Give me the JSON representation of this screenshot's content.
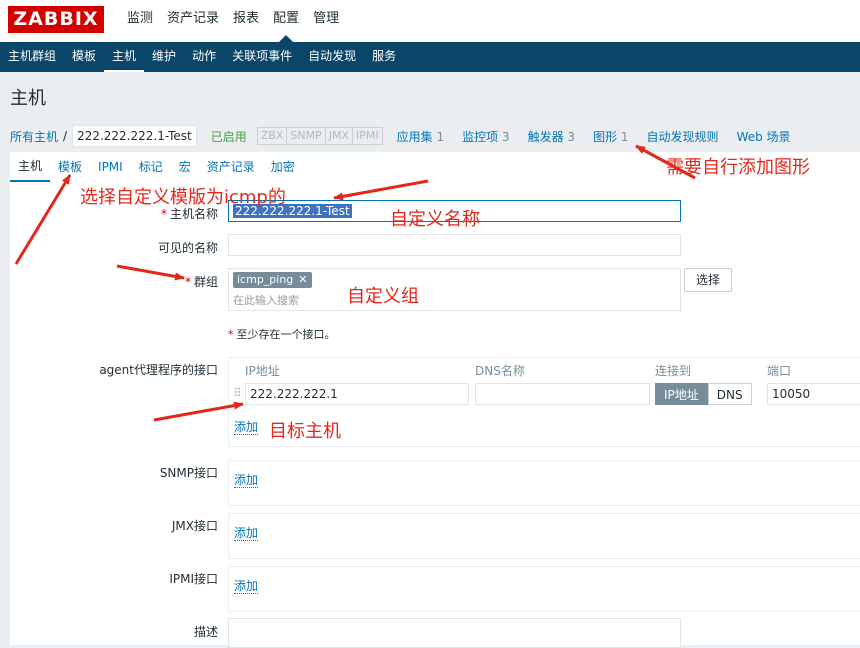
{
  "header": {
    "logo": "ZABBIX",
    "nav": [
      "监测",
      "资产记录",
      "报表",
      "配置",
      "管理"
    ],
    "active_nav": "配置"
  },
  "subnav": {
    "items": [
      "主机群组",
      "模板",
      "主机",
      "维护",
      "动作",
      "关联项事件",
      "自动发现",
      "服务"
    ],
    "active": "主机"
  },
  "page_title": "主机",
  "breadcrumb": {
    "all_hosts": "所有主机",
    "separator": "/",
    "current": "222.222.222.1-Test",
    "status": "已启用",
    "availability": [
      "ZBX",
      "SNMP",
      "JMX",
      "IPMI"
    ],
    "links": [
      {
        "label": "应用集",
        "count": "1"
      },
      {
        "label": "监控项",
        "count": "3"
      },
      {
        "label": "触发器",
        "count": "3"
      },
      {
        "label": "图形",
        "count": "1"
      },
      {
        "label": "自动发现规则",
        "count": ""
      },
      {
        "label": "Web 场景",
        "count": ""
      }
    ]
  },
  "tabs": [
    "主机",
    "模板",
    "IPMI",
    "标记",
    "宏",
    "资产记录",
    "加密"
  ],
  "active_tab": "主机",
  "form": {
    "hostname_label": "主机名称",
    "hostname_value": "222.222.222.1-Test",
    "visible_name_label": "可见的名称",
    "visible_name_value": "",
    "groups_label": "群组",
    "group_tag": "icmp_ping",
    "groups_placeholder": "在此输入搜索",
    "select_button": "选择",
    "interface_note": "至少存在一个接口。",
    "agent_label": "agent代理程序的接口",
    "col_ip": "IP地址",
    "col_dns": "DNS名称",
    "col_connect": "连接到",
    "col_port": "端口",
    "ip_value": "222.222.222.1",
    "dns_value": "",
    "connect_ip": "IP地址",
    "connect_dns": "DNS",
    "port_value": "10050",
    "add_label": "添加",
    "snmp_label": "SNMP接口",
    "jmx_label": "JMX接口",
    "ipmi_label": "IPMI接口",
    "description_label": "描述"
  },
  "annotations": {
    "template": "选择自定义模版为icmp的",
    "name": "自定义名称",
    "group": "自定义组",
    "target": "目标主机",
    "graph": "需要自行添加图形"
  },
  "colors": {
    "accent_red": "#e4271b",
    "nav_bg": "#0a466a",
    "link": "#0275b8",
    "logo_bg": "#d40000"
  }
}
